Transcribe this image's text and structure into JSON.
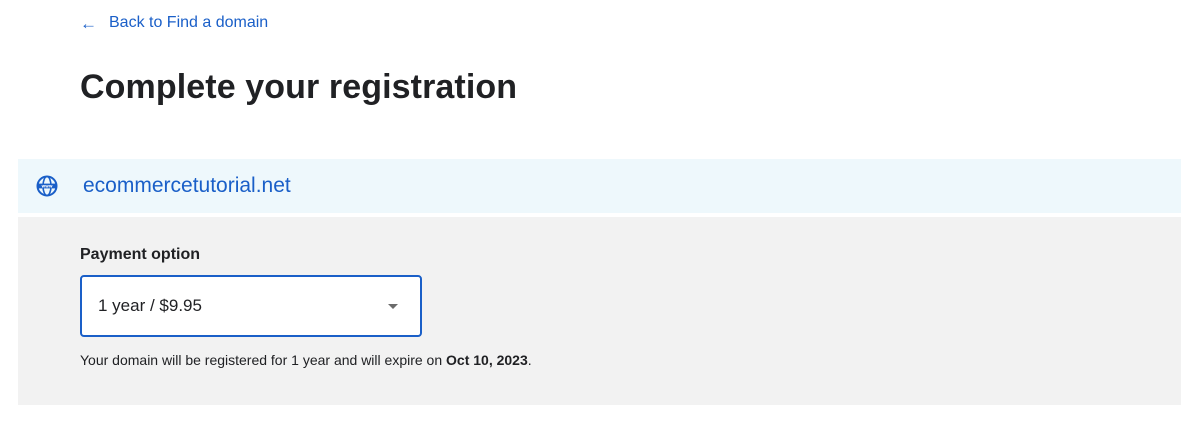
{
  "nav": {
    "back_label": "Back to Find a domain"
  },
  "page": {
    "title": "Complete your registration"
  },
  "domain": {
    "name": "ecommercetutorial.net"
  },
  "payment": {
    "label": "Payment option",
    "selected_option": "1 year / $9.95",
    "note_prefix": "Your domain will be registered for 1 year and will expire on ",
    "expiry_date": "Oct 10, 2023",
    "note_suffix": "."
  },
  "icons": {
    "back": "arrow-left-icon",
    "domain": "globe-icon",
    "dropdown": "caret-down-icon"
  },
  "colors": {
    "link": "#1a5fc8",
    "domain_bar_bg": "#eef8fc",
    "panel_bg": "#f2f2f2",
    "select_border": "#1a5fc8"
  }
}
